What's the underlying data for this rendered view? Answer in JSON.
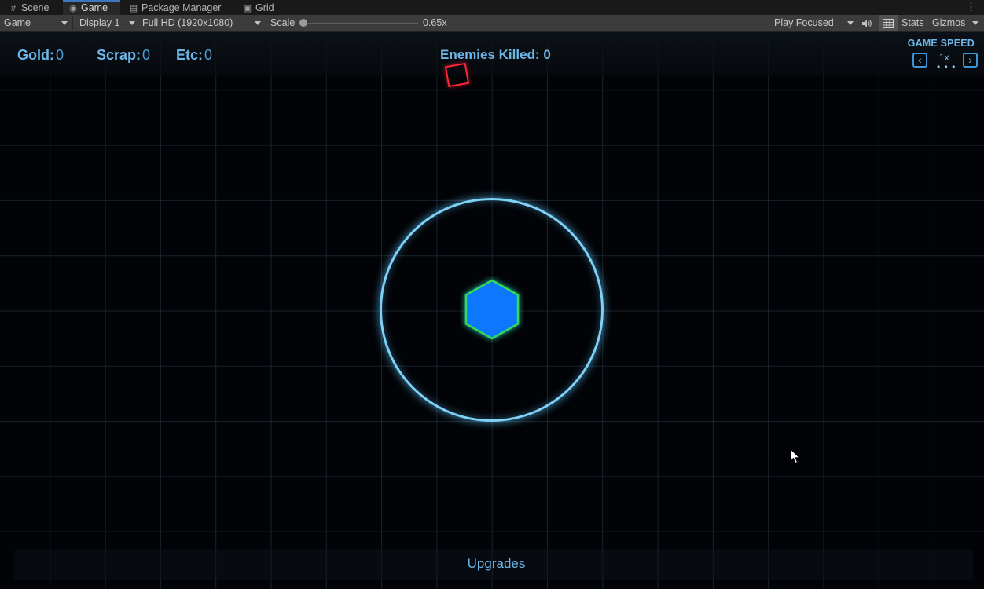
{
  "tabs": [
    {
      "icon": "#",
      "label": "Scene"
    },
    {
      "icon": "◉",
      "label": "Game"
    },
    {
      "icon": "▤",
      "label": "Package Manager"
    },
    {
      "icon": "▣",
      "label": "Grid"
    }
  ],
  "tab_menu": "⋮",
  "toolbar": {
    "view_select": "Game",
    "display_select": "Display 1",
    "resolution_select": "Full HD (1920x1080)",
    "scale_label": "Scale",
    "scale_value": "0.65x",
    "scale_fraction": 0.0,
    "play_mode_select": "Play Focused",
    "stats_label": "Stats",
    "gizmos_label": "Gizmos"
  },
  "hud": {
    "gold_label": "Gold:",
    "gold_value": "0",
    "scrap_label": "Scrap:",
    "scrap_value": "0",
    "etc_label": "Etc:",
    "etc_value": "0",
    "enemies_killed": "Enemies Killed: 0",
    "game_speed_title": "GAME SPEED",
    "game_speed_value": "1x",
    "game_speed_dots": "• • •",
    "prev_speed_glyph": "‹",
    "next_speed_glyph": "›"
  },
  "upgrades_label": "Upgrades",
  "colors": {
    "hud_text": "#6cb6e8",
    "enemy": "#ff2538",
    "range_ring": "#7fd1f7",
    "core_fill": "#0a78ff",
    "core_outline": "#33dd55"
  }
}
